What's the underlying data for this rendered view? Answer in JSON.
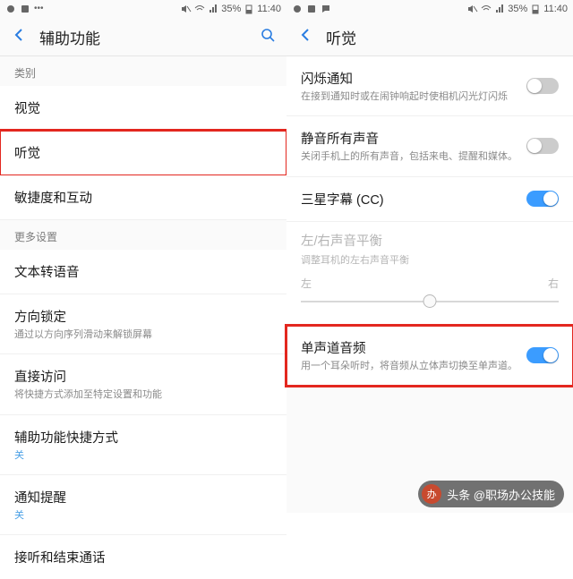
{
  "status": {
    "battery": "35%",
    "time": "11:40"
  },
  "left": {
    "title": "辅助功能",
    "section_category": "类别",
    "items": {
      "vision": "视觉",
      "hearing": "听觉",
      "dexterity": "敏捷度和互动"
    },
    "section_more": "更多设置",
    "more": {
      "tts": {
        "title": "文本转语音"
      },
      "orientation": {
        "title": "方向锁定",
        "desc": "通过以方向序列滑动来解锁屏幕"
      },
      "direct": {
        "title": "直接访问",
        "desc": "将快捷方式添加至特定设置和功能"
      },
      "shortcut": {
        "title": "辅助功能快捷方式",
        "desc": "关"
      },
      "reminder": {
        "title": "通知提醒",
        "desc": "关"
      },
      "calls": {
        "title": "接听和结束通话"
      }
    }
  },
  "right": {
    "title": "听觉",
    "flash": {
      "title": "闪烁通知",
      "desc": "在接到通知时或在闹钟响起时使相机闪光灯闪烁"
    },
    "mute": {
      "title": "静音所有声音",
      "desc": "关闭手机上的所有声音，包括来电、提醒和媒体。"
    },
    "cc": {
      "title": "三星字幕 (CC)"
    },
    "balance": {
      "title": "左/右声音平衡",
      "desc": "调整耳机的左右声音平衡",
      "left": "左",
      "right": "右"
    },
    "mono": {
      "title": "单声道音频",
      "desc": "用一个耳朵听时，将音频从立体声切换至单声道。"
    }
  },
  "watermark": {
    "text": "头条 @职场办公技能"
  }
}
